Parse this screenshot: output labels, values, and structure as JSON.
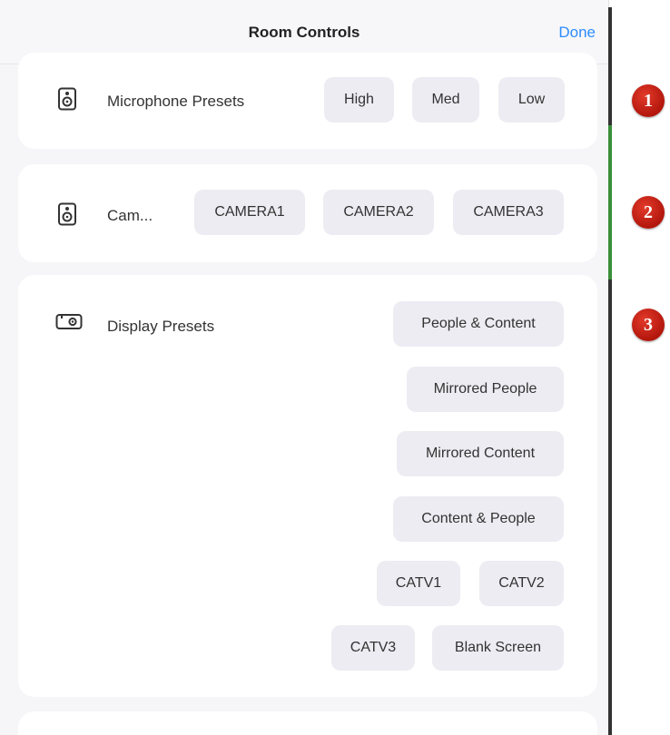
{
  "header": {
    "title": "Room Controls",
    "done_label": "Done"
  },
  "microphone": {
    "label": "Microphone Presets",
    "icon": "speaker-icon",
    "buttons": [
      "High",
      "Med",
      "Low"
    ]
  },
  "camera": {
    "label": "Cam...",
    "icon": "speaker-icon",
    "buttons": [
      "CAMERA1",
      "CAMERA2",
      "CAMERA3"
    ]
  },
  "display": {
    "label": "Display Presets",
    "icon": "projector-icon",
    "buttons": [
      "People & Content",
      "Mirrored People",
      "Mirrored Content",
      "Content & People",
      "CATV1",
      "CATV2",
      "CATV3",
      "Blank Screen"
    ]
  },
  "badges": [
    "1",
    "2",
    "3"
  ],
  "colors": {
    "accent": "#2d8cff",
    "badge": "#c8200f",
    "button_bg": "#ececf2"
  }
}
